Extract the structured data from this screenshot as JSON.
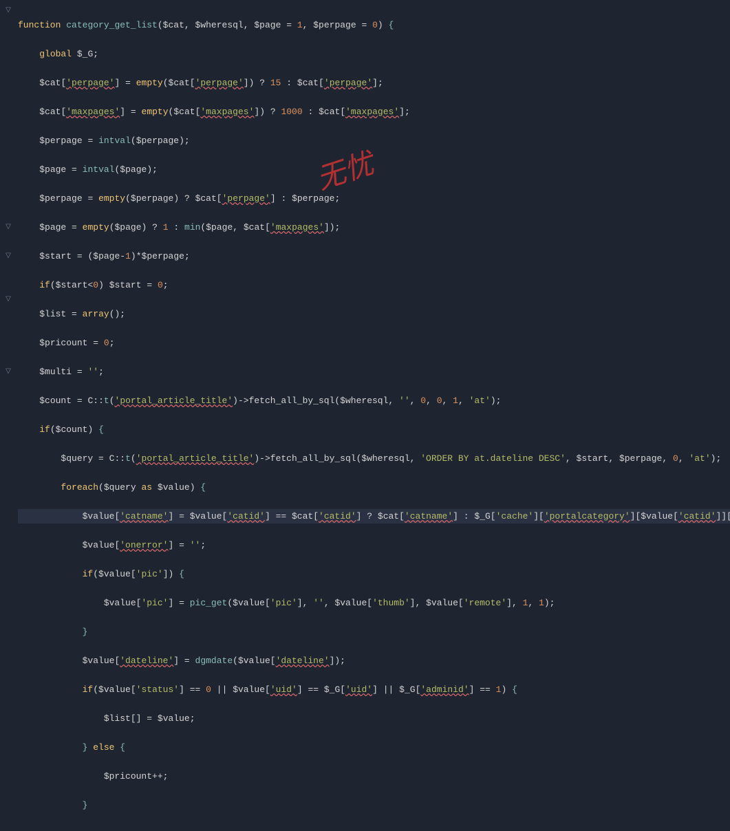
{
  "watermark": "无忧",
  "gutter": [
    "▽",
    "",
    "",
    "",
    "",
    "",
    "",
    "",
    "",
    "",
    "",
    "",
    "",
    "",
    "",
    "▽",
    "",
    "▽",
    "",
    "",
    "▽",
    "",
    "",
    "",
    "",
    "▽",
    "",
    "",
    "",
    "",
    ""
  ],
  "code": {
    "l1": "function category_get_list($cat, $wheresql, $page = 1, $perpage = 0) {",
    "l2": "    global $_G;",
    "l3": "    $cat['perpage'] = empty($cat['perpage']) ? 15 : $cat['perpage'];",
    "l4": "    $cat['maxpages'] = empty($cat['maxpages']) ? 1000 : $cat['maxpages'];",
    "l5": "    $perpage = intval($perpage);",
    "l6": "    $page = intval($page);",
    "l7": "    $perpage = empty($perpage) ? $cat['perpage'] : $perpage;",
    "l8": "    $page = empty($page) ? 1 : min($page, $cat['maxpages']);",
    "l9": "    $start = ($page-1)*$perpage;",
    "l10": "    if($start<0) $start = 0;",
    "l11": "    $list = array();",
    "l12": "    $pricount = 0;",
    "l13": "    $multi = '';",
    "l14": "    $count = C::t('portal_article_title')->fetch_all_by_sql($wheresql, '', 0, 0, 1, 'at');",
    "l15": "    if($count) {",
    "l16": "        $query = C::t('portal_article_title')->fetch_all_by_sql($wheresql, 'ORDER BY at.dateline DESC', $start, $perpage, 0, 'at');",
    "l17": "        foreach($query as $value) {",
    "l18": "            $value['catname'] = $value['catid'] == $cat['catid'] ? $cat['catname'] : $_G['cache']['portalcategory'][$value['catid']]['catname'];",
    "l19": "            $value['onerror'] = '';",
    "l20": "            if($value['pic']) {",
    "l21": "                $value['pic'] = pic_get($value['pic'], '', $value['thumb'], $value['remote'], 1, 1);",
    "l22": "            }",
    "l23": "            $value['dateline'] = dgmdate($value['dateline']);",
    "l24": "            if($value['status'] == 0 || $value['uid'] == $_G['uid'] || $_G['adminid'] == 1) {",
    "l25": "                $list[] = $value;",
    "l26": "            } else {",
    "l27": "                $pricount++;",
    "l28": "            }"
  }
}
